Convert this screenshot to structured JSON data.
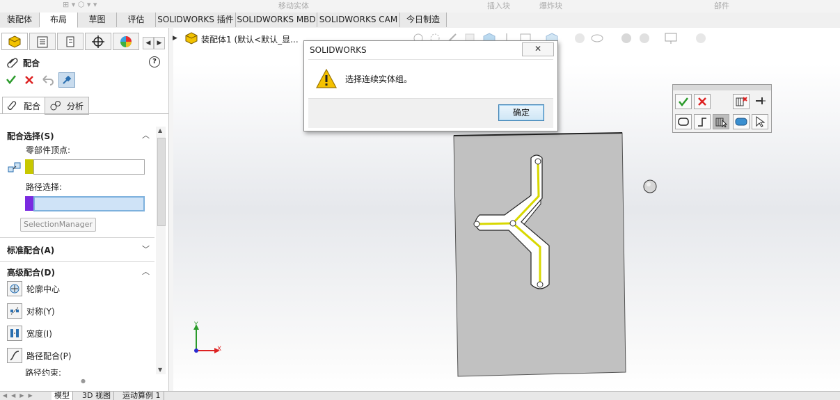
{
  "ribbon_ghost": {
    "move_solid": "移动实体",
    "insert_block": "插入块",
    "explode_block": "爆炸块",
    "part": "部件"
  },
  "tabs": [
    {
      "label": "装配体"
    },
    {
      "label": "布局"
    },
    {
      "label": "草图"
    },
    {
      "label": "评估"
    },
    {
      "label": "SOLIDWORKS 插件"
    },
    {
      "label": "SOLIDWORKS MBD"
    },
    {
      "label": "SOLIDWORKS CAM"
    },
    {
      "label": "今日制造"
    }
  ],
  "property_manager": {
    "title": "配合",
    "subtabs": {
      "mates": "配合",
      "analysis": "分析"
    },
    "mate_selection": {
      "header": "配合选择(S)",
      "vertex_label": "零部件顶点:",
      "path_label": "路径选择:",
      "selection_manager": "SelectionManager"
    },
    "standard_header": "标准配合(A)",
    "advanced_header": "高级配合(D)",
    "advanced_items": [
      {
        "label": "轮廓中心"
      },
      {
        "label": "对称(Y)"
      },
      {
        "label": "宽度(I)"
      },
      {
        "label": "路径配合(P)"
      },
      {
        "label": "路径约束:"
      }
    ],
    "colors": {
      "vertex_swatch": "#c8c800",
      "path_swatch": "#7a2ae0",
      "accent": "#2a6fb0"
    }
  },
  "tree": {
    "label": "装配体1 (默认<默认_显..."
  },
  "dialog": {
    "title": "SOLIDWORKS",
    "close": "✕",
    "message": "选择连续实体组。",
    "ok": "确定"
  },
  "triad": {
    "x": "X",
    "y": "Y"
  },
  "bottom_tabs": [
    {
      "label": "模型"
    },
    {
      "label": "3D 视图"
    },
    {
      "label": "运动算例 1"
    }
  ]
}
